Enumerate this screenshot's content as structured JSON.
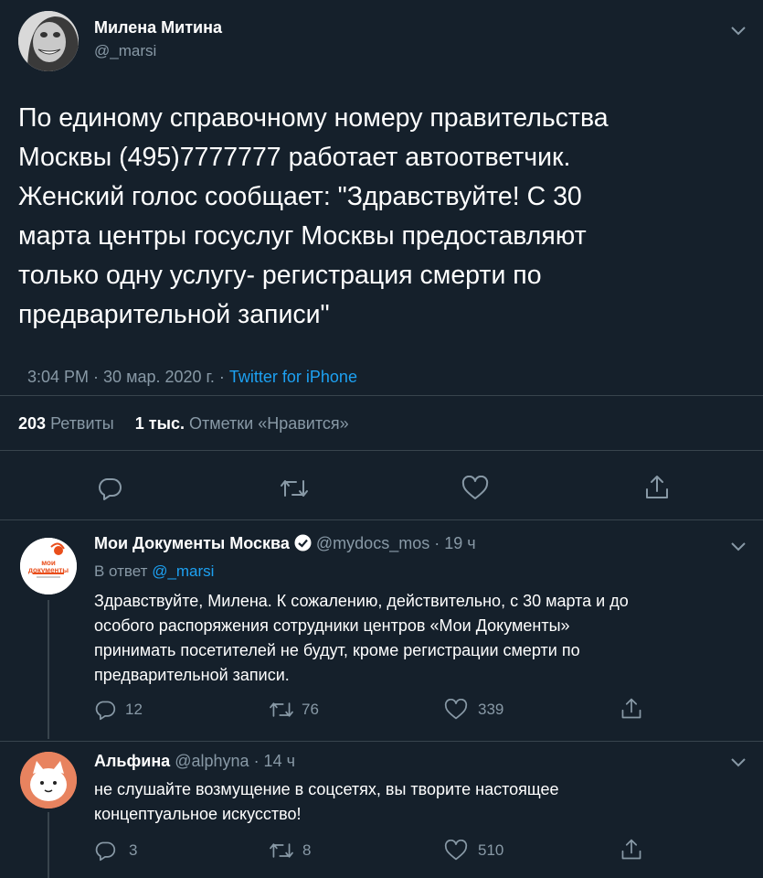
{
  "main_tweet": {
    "display_name": "Милена Митина",
    "handle": "@_marsi",
    "text_lines": [
      "По единому справочному номеру правительства",
      "Москвы (495)7777777 работает автоответчик.",
      "Женский голос сообщает: \"Здравствуйте!  С 30",
      "марта центры госуслуг Москвы предоставляют",
      "только одну услугу- регистрация смерти по",
      "предварительной записи\""
    ],
    "time": "3:04 PM · 30 мар. 2020 г. · ",
    "source": "Twitter for iPhone",
    "retweets_count": "203",
    "retweets_label": "Ретвиты",
    "likes_count": "1 тыс.",
    "likes_label": "Отметки «Нравится»"
  },
  "reply1": {
    "display_name": "Мои Документы Москва",
    "handle": "@mydocs_mos",
    "time": "· 19 ч",
    "reply_prefix": "В ответ",
    "reply_to": "@_marsi",
    "avatar_text": "мои документы",
    "text_lines": [
      "Здравствуйте, Милена. К сожалению, действительно, с 30 марта и до",
      "особого распоряжения сотрудники центров «Мои Документы»",
      "принимать посетителей не будут, кроме регистрации смерти по",
      "предварительной записи."
    ],
    "replies": "12",
    "retweets": "76",
    "likes": "339"
  },
  "reply2": {
    "display_name": "Альфина",
    "handle": "@alphyna",
    "time": "· 14 ч",
    "text_lines": [
      "не слушайте возмущение в соцсетях, вы творите настоящее",
      "концептуальное искусство!"
    ],
    "replies": "3",
    "retweets": "8",
    "likes": "510"
  },
  "colors": {
    "background": "#15202b",
    "muted": "#8899a6",
    "link": "#1da1f2",
    "divider": "#38444d"
  }
}
